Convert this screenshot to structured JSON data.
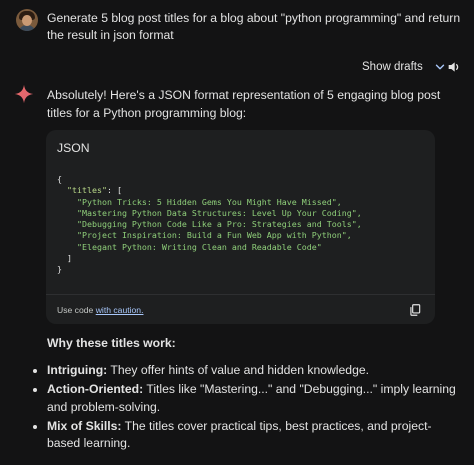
{
  "user_prompt": "Generate 5 blog post titles for a blog about \"python programming\" and return the result in json format",
  "show_drafts_label": "Show drafts",
  "response": {
    "intro": "Absolutely! Here's a JSON format representation of 5 engaging blog post titles for a Python programming blog:",
    "code_block": {
      "language": "JSON",
      "open_brace": "{",
      "key": "\"titles\"",
      "open_bracket": ": [",
      "titles": [
        "\"Python Tricks: 5 Hidden Gems You Might Have Missed\",",
        "\"Mastering Python Data Structures: Level Up Your Coding\",",
        "\"Debugging Python Code Like a Pro: Strategies and Tools\",",
        "\"Project Inspiration: Build a Fun Web App with Python\",",
        "\"Elegant Python: Writing Clean and Readable Code\""
      ],
      "close_bracket": "]",
      "close_brace": "}",
      "footer_prefix": "Use code ",
      "footer_link": "with caution."
    },
    "why_heading": "Why these titles work:",
    "bullets": [
      {
        "label": "Intriguing:",
        "text": " They offer hints of value and hidden knowledge."
      },
      {
        "label": "Action-Oriented:",
        "text": " Titles like \"Mastering...\" and \"Debugging...\" imply learning and problem-solving."
      },
      {
        "label": "Mix of Skills:",
        "text": " The titles cover practical tips, best practices, and project-based learning."
      }
    ]
  },
  "icons": {
    "avatar": "user-avatar",
    "drafts": "chevron-down-icon",
    "speaker": "volume-icon",
    "spark": "gemini-spark-icon",
    "copy": "copy-icon"
  },
  "colors": {
    "background": "#131314",
    "code_bg": "#1e1f20",
    "string_green": "#8fcf7a",
    "link_blue": "#a8c7fa"
  }
}
